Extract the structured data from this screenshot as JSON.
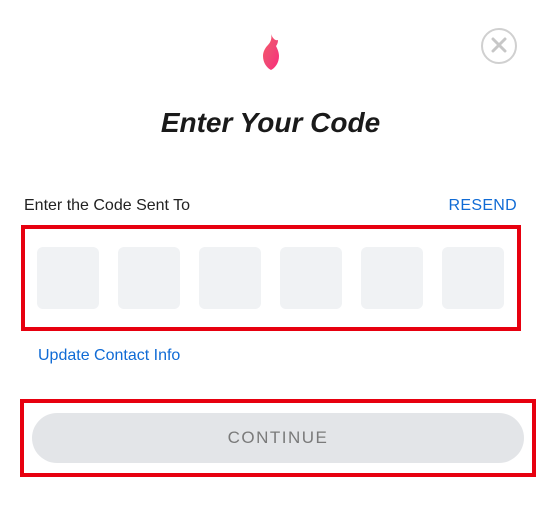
{
  "title": "Enter Your Code",
  "prompt": "Enter the Code Sent To",
  "resend_label": "RESEND",
  "update_contact_label": "Update Contact Info",
  "continue_label": "CONTINUE",
  "code_inputs": [
    "",
    "",
    "",
    "",
    "",
    ""
  ],
  "colors": {
    "accent_link": "#106bd5",
    "highlight_border": "#e7000f",
    "input_bg": "#f0f2f4",
    "button_bg": "#e3e5e8",
    "button_text": "#7a7a7a"
  },
  "icons": {
    "logo": "flame-icon",
    "close": "close-icon"
  }
}
